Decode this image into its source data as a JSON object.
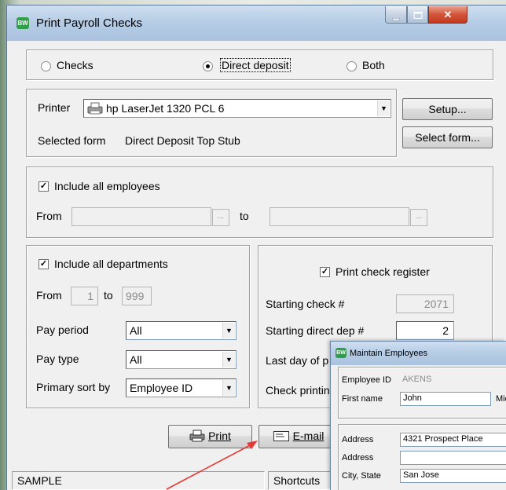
{
  "window": {
    "title": "Print Payroll Checks",
    "app_icon_text": "BW"
  },
  "output_type": {
    "options": [
      "Checks",
      "Direct deposit",
      "Both"
    ],
    "selected": "Direct deposit"
  },
  "printer": {
    "label": "Printer",
    "value": "hp LaserJet 1320 PCL 6",
    "selected_form_label": "Selected form",
    "selected_form_value": "Direct Deposit Top Stub",
    "setup_label": "Setup...",
    "select_form_label": "Select form..."
  },
  "employees": {
    "include_all_label": "Include all employees",
    "include_all_checked": true,
    "from_label": "From",
    "to_label": "to",
    "from_value": "",
    "to_value": "",
    "lookup_label": "..."
  },
  "departments": {
    "include_all_label": "Include all departments",
    "include_all_checked": true,
    "from_label": "From",
    "from_value": "1",
    "to_label": "to",
    "to_value": "999",
    "pay_period_label": "Pay period",
    "pay_period_value": "All",
    "pay_type_label": "Pay type",
    "pay_type_value": "All",
    "primary_sort_label": "Primary sort by",
    "primary_sort_value": "Employee ID"
  },
  "register": {
    "print_check_register_label": "Print check register",
    "print_check_register_checked": true,
    "starting_check_label": "Starting check #",
    "starting_check_value": "2071",
    "starting_dd_label": "Starting direct dep #",
    "starting_dd_value": "2",
    "last_day_label": "Last day of p",
    "check_printing_label": "Check printin"
  },
  "actions": {
    "print_label": "Print",
    "email_label": "E-mail"
  },
  "status_bar": {
    "left": "SAMPLE",
    "shortcuts": "Shortcuts"
  },
  "maintain_employees": {
    "title": "Maintain Employees",
    "employee_id_label": "Employee ID",
    "employee_id_value": "AKENS",
    "first_name_label": "First name",
    "first_name_value": "John",
    "middle_label": "Midd",
    "address_label": "Address",
    "address_value": "4321 Prospect Place",
    "address2_label": "Address",
    "address2_value": "",
    "city_state_label": "City, State",
    "city_state_value": "San Jose"
  },
  "colors": {
    "annotation_arrow": "#e53935",
    "title_bar": "#b7cde6",
    "close_button": "#d2553a",
    "app_icon": "#2f9e4a"
  }
}
